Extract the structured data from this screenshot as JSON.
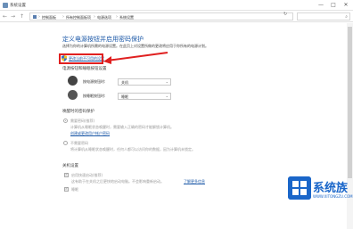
{
  "window": {
    "title": "系统设置",
    "controls": [
      "—",
      "□",
      "✕"
    ]
  },
  "address_bar": {
    "back": "←",
    "forward": "→",
    "up": "↑",
    "crumbs": [
      "控制面板",
      "所有控制面板项",
      "电源选项",
      "系统设置"
    ],
    "refresh": "↻",
    "search_icon": "search-icon"
  },
  "page": {
    "heading": "定义电源按钮并启用密码保护",
    "desc1": "选择为你的计算机所需的电源设置。在此页上对设置所做的更改将应用于你所有的电源计划。",
    "desc2": "",
    "link_admin": "更改当前不可用的设置",
    "section_buttons": "电源按钮和睡眠按钮设置",
    "power_button": {
      "label": "按电源按钮时:",
      "value": "关机"
    },
    "sleep_button": {
      "label": "按睡眠按钮时:",
      "value": "睡眠"
    },
    "section_wake": "唤醒时的密码保护",
    "opt_require": "需要密码(推荐)",
    "opt_require_desc": "计算机从睡眠状态唤醒时，需要输入正确的密码才能解锁计算机。",
    "opt_require_link": "创建或更改用户帐户密码",
    "opt_norequire": "不需要密码",
    "opt_norequire_desc": "将计算机从睡眠状态唤醒时，任何人都可以访问你的数据，因为计算机未锁定。",
    "section_shutdown": "关机设置",
    "chk_fast": "启用快速启动(推荐)",
    "chk_fast_desc": "这有助于在关机之后更快地启动电脑。不会影响重新启动。",
    "chk_fast_link": "了解更多信息",
    "chk_sleep": "睡眠"
  },
  "watermark": {
    "brand": "系统族",
    "url": "WWW.XITONGZU.COM"
  },
  "colors": {
    "link": "#1e5aa8",
    "highlight": "#e02020",
    "brand": "#1a66c9"
  }
}
